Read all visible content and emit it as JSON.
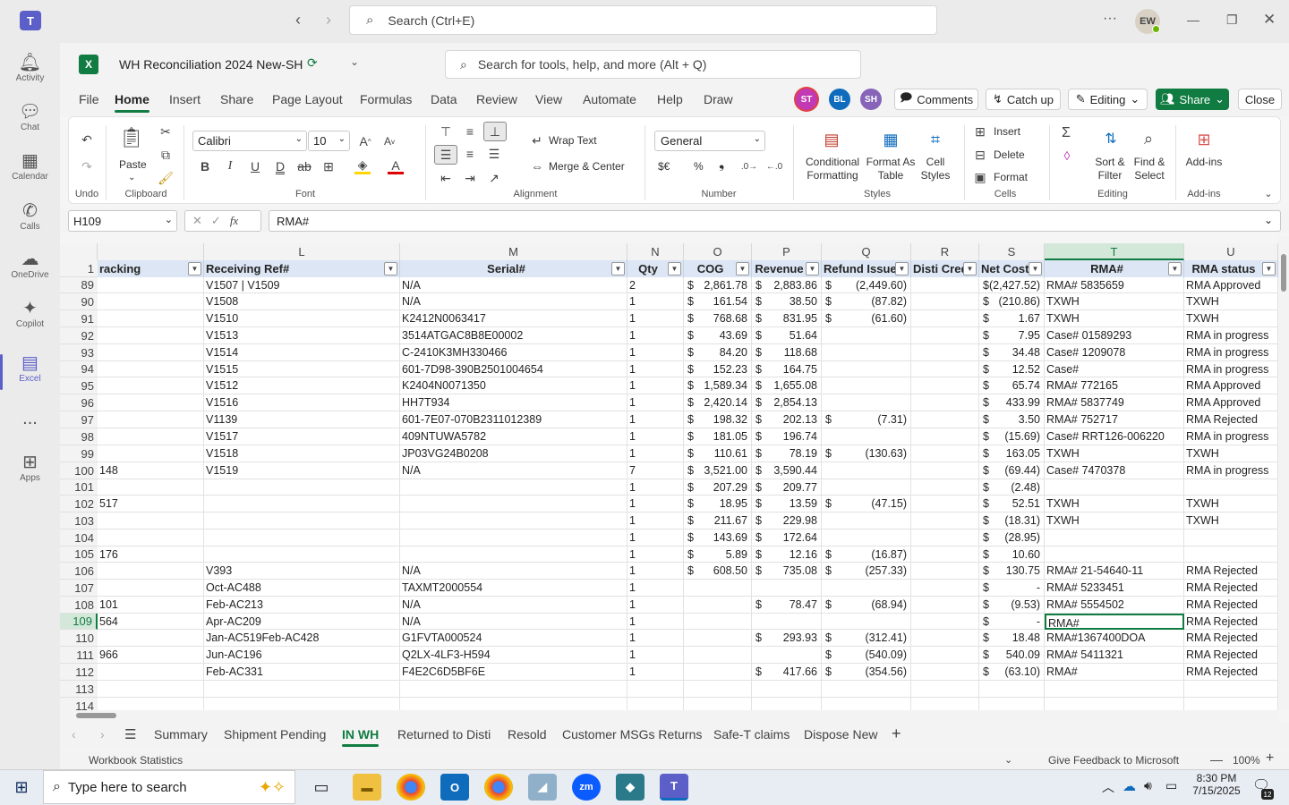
{
  "teams": {
    "search_placeholder": "Search (Ctrl+E)",
    "user_initials": "EW",
    "rail": [
      {
        "label": "Activity",
        "icon": "bell-icon"
      },
      {
        "label": "Chat",
        "icon": "chat-icon"
      },
      {
        "label": "Calendar",
        "icon": "calendar-icon"
      },
      {
        "label": "Calls",
        "icon": "phone-icon"
      },
      {
        "label": "OneDrive",
        "icon": "cloud-icon"
      },
      {
        "label": "Copilot",
        "icon": "copilot-icon"
      },
      {
        "label": "Excel",
        "icon": "excel-icon"
      },
      {
        "label": "...",
        "icon": "more-icon"
      },
      {
        "label": "Apps",
        "icon": "apps-icon"
      }
    ]
  },
  "excel": {
    "workbook_title": "WH Reconciliation 2024 New-SH",
    "tools_search": "Search for tools, help, and more (Alt + Q)",
    "tabs": [
      "File",
      "Home",
      "Insert",
      "Share",
      "Page Layout",
      "Formulas",
      "Data",
      "Review",
      "View",
      "Automate",
      "Help",
      "Draw"
    ],
    "active_tab": "Home",
    "presence": [
      {
        "initials": "ST",
        "color": "#c239b3"
      },
      {
        "initials": "BL",
        "color": "#0f6cbd"
      },
      {
        "initials": "SH",
        "color": "#8764b8"
      }
    ],
    "buttons": {
      "comments": "Comments",
      "catchup": "Catch up",
      "editing": "Editing",
      "share": "Share",
      "close": "Close"
    },
    "ribbon": {
      "undo_group": "Undo",
      "clipboard_group": "Clipboard",
      "paste": "Paste",
      "font_group": "Font",
      "font_name": "Calibri",
      "font_size": "10",
      "alignment_group": "Alignment",
      "wrap_text": "Wrap Text",
      "merge_center": "Merge & Center",
      "number_group": "Number",
      "number_format": "General",
      "currency": "$€",
      "percent": "%",
      "comma": "❟",
      "styles_group": "Styles",
      "conditional": "Conditional",
      "formatting": "Formatting",
      "format_as": "Format As",
      "table": "Table",
      "cell": "Cell",
      "styles": "Styles",
      "cells_group": "Cells",
      "insert": "Insert",
      "delete": "Delete",
      "format": "Format",
      "editing_group": "Editing",
      "sort": "Sort &",
      "filter": "Filter",
      "find": "Find &",
      "select": "Select",
      "addins_group": "Add-ins",
      "addins": "Add-ins"
    },
    "name_box": "H109",
    "formula": "RMA#",
    "columns": [
      {
        "letter": "",
        "header": "racking"
      },
      {
        "letter": "L",
        "header": "Receiving Ref#"
      },
      {
        "letter": "M",
        "header": "Serial#"
      },
      {
        "letter": "N",
        "header": "Qty"
      },
      {
        "letter": "O",
        "header": "COG"
      },
      {
        "letter": "P",
        "header": "Revenue"
      },
      {
        "letter": "Q",
        "header": "Refund Issued"
      },
      {
        "letter": "R",
        "header": "Disti Credit"
      },
      {
        "letter": "S",
        "header": "Net Cost"
      },
      {
        "letter": "T",
        "header": "RMA#"
      },
      {
        "letter": "U",
        "header": "RMA status"
      }
    ],
    "rows": [
      {
        "n": "89",
        "k": "",
        "l": "V1507 | V1509",
        "m": "N/A",
        "q": "2",
        "o": "2,861.78",
        "p": "2,883.86",
        "r": "(2,449.60)",
        "s": "(2,427.52)",
        "t": "RMA# 5835659",
        "u": "RMA Approved"
      },
      {
        "n": "90",
        "k": "",
        "l": "V1508",
        "m": "N/A",
        "q": "1",
        "o": "161.54",
        "p": "38.50",
        "r": "(87.82)",
        "s": "(210.86)",
        "t": "TXWH",
        "u": "TXWH"
      },
      {
        "n": "91",
        "k": "",
        "l": "V1510",
        "m": "K2412N0063417",
        "q": "1",
        "o": "768.68",
        "p": "831.95",
        "r": "(61.60)",
        "s": "1.67",
        "t": "TXWH",
        "u": "TXWH"
      },
      {
        "n": "92",
        "k": "",
        "l": "V1513",
        "m": "3514ATGAC8B8E00002",
        "q": "1",
        "o": "43.69",
        "p": "51.64",
        "r": "",
        "s": "7.95",
        "t": "Case# 01589293",
        "u": "RMA in progress"
      },
      {
        "n": "93",
        "k": "",
        "l": "V1514",
        "m": "C-2410K3MH330466",
        "q": "1",
        "o": "84.20",
        "p": "118.68",
        "r": "",
        "s": "34.48",
        "t": "Case# 1209078",
        "u": "RMA in progress"
      },
      {
        "n": "94",
        "k": "",
        "l": "V1515",
        "m": "601-7D98-390B2501004654",
        "q": "1",
        "o": "152.23",
        "p": "164.75",
        "r": "",
        "s": "12.52",
        "t": "Case#",
        "u": "RMA in progress"
      },
      {
        "n": "95",
        "k": "",
        "l": "V1512",
        "m": "K2404N0071350",
        "q": "1",
        "o": "1,589.34",
        "p": "1,655.08",
        "r": "",
        "s": "65.74",
        "t": "RMA# 772165",
        "u": "RMA Approved"
      },
      {
        "n": "96",
        "k": "",
        "l": "V1516",
        "m": "HH7T934",
        "q": "1",
        "o": "2,420.14",
        "p": "2,854.13",
        "r": "",
        "s": "433.99",
        "t": "RMA# 5837749",
        "u": "RMA Approved"
      },
      {
        "n": "97",
        "k": "",
        "l": "V1139",
        "m": "601-7E07-070B2311012389",
        "q": "1",
        "o": "198.32",
        "p": "202.13",
        "r": "(7.31)",
        "s": "3.50",
        "t": "RMA# 752717",
        "u": "RMA Rejected"
      },
      {
        "n": "98",
        "k": "",
        "l": "V1517",
        "m": "409NTUWA5782",
        "q": "1",
        "o": "181.05",
        "p": "196.74",
        "r": "",
        "s": "(15.69)",
        "t": "Case# RRT126-006220",
        "u": "RMA in progress"
      },
      {
        "n": "99",
        "k": "",
        "l": "V1518",
        "m": "JP03VG24B0208",
        "q": "1",
        "o": "110.61",
        "p": "78.19",
        "r": "(130.63)",
        "s": "163.05",
        "t": "TXWH",
        "u": "TXWH"
      },
      {
        "n": "100",
        "k": "148",
        "l": "V1519",
        "m": "N/A",
        "q": "7",
        "o": "3,521.00",
        "p": "3,590.44",
        "r": "",
        "s": "(69.44)",
        "t": "Case# 7470378",
        "u": "RMA in progress"
      },
      {
        "n": "101",
        "k": "",
        "l": "",
        "m": "",
        "q": "1",
        "o": "207.29",
        "p": "209.77",
        "r": "",
        "s": "(2.48)",
        "t": "",
        "u": ""
      },
      {
        "n": "102",
        "k": "517",
        "l": "",
        "m": "",
        "q": "1",
        "o": "18.95",
        "p": "13.59",
        "r": "(47.15)",
        "s": "52.51",
        "t": "TXWH",
        "u": "TXWH"
      },
      {
        "n": "103",
        "k": "",
        "l": "",
        "m": "",
        "q": "1",
        "o": "211.67",
        "p": "229.98",
        "r": "",
        "s": "(18.31)",
        "t": "TXWH",
        "u": "TXWH"
      },
      {
        "n": "104",
        "k": "",
        "l": "",
        "m": "",
        "q": "1",
        "o": "143.69",
        "p": "172.64",
        "r": "",
        "s": "(28.95)",
        "t": "",
        "u": ""
      },
      {
        "n": "105",
        "k": "176",
        "l": "",
        "m": "",
        "q": "1",
        "o": "5.89",
        "p": "12.16",
        "r": "(16.87)",
        "s": "10.60",
        "t": "",
        "u": ""
      },
      {
        "n": "106",
        "k": "",
        "l": "V393",
        "m": "N/A",
        "q": "1",
        "o": "608.50",
        "p": "735.08",
        "r": "(257.33)",
        "s": "130.75",
        "t": "RMA# 21-54640-11",
        "u": "RMA Rejected"
      },
      {
        "n": "107",
        "k": "",
        "l": "Oct-AC488",
        "m": "TAXMT2000554",
        "q": "1",
        "o": "",
        "p": "",
        "r": "",
        "s": "-",
        "t": "RMA# 5233451",
        "u": "RMA Rejected"
      },
      {
        "n": "108",
        "k": "101",
        "l": "Feb-AC213",
        "m": "N/A",
        "q": "1",
        "o": "",
        "p": "78.47",
        "r": "(68.94)",
        "s": "(9.53)",
        "t": "RMA# 5554502",
        "u": "RMA Rejected"
      },
      {
        "n": "109",
        "k": "564",
        "l": "Apr-AC209",
        "m": "N/A",
        "q": "1",
        "o": "",
        "p": "",
        "r": "",
        "s": "-",
        "t": "RMA#",
        "u": "RMA Rejected"
      },
      {
        "n": "110",
        "k": "",
        "l": "Jan-AC519Feb-AC428",
        "m": "G1FVTA000524",
        "q": "1",
        "o": "",
        "p": "293.93",
        "r": "(312.41)",
        "s": "18.48",
        "t": "RMA#1367400DOA",
        "u": "RMA Rejected"
      },
      {
        "n": "111",
        "k": "966",
        "l": "Jun-AC196",
        "m": "Q2LX-4LF3-H594",
        "q": "1",
        "o": "",
        "p": "",
        "r": "(540.09)",
        "s": "540.09",
        "t": "RMA# 5411321",
        "u": "RMA Rejected"
      },
      {
        "n": "112",
        "k": "",
        "l": "Feb-AC331",
        "m": "F4E2C6D5BF6E",
        "q": "1",
        "o": "",
        "p": "417.66",
        "r": "(354.56)",
        "s": "(63.10)",
        "t": "RMA#",
        "u": "RMA Rejected"
      },
      {
        "n": "113",
        "k": "",
        "l": "",
        "m": "",
        "q": "",
        "o": "",
        "p": "",
        "r": "",
        "s": "",
        "t": "",
        "u": ""
      },
      {
        "n": "114",
        "k": "",
        "l": "",
        "m": "",
        "q": "",
        "o": "",
        "p": "",
        "r": "",
        "s": "",
        "t": "",
        "u": ""
      }
    ],
    "sheets": [
      "Summary",
      "Shipment Pending",
      "IN WH",
      "Returned to Disti",
      "Resold",
      "Customer MSGs Returns",
      "Safe-T claims",
      "Dispose New"
    ],
    "active_sheet": "IN WH",
    "status_left": "Workbook Statistics",
    "feedback": "Give Feedback to Microsoft",
    "zoom": "100%"
  },
  "taskbar": {
    "search_placeholder": "Type here to search",
    "time": "8:30 PM",
    "date": "7/15/2025",
    "notifications": "12"
  }
}
